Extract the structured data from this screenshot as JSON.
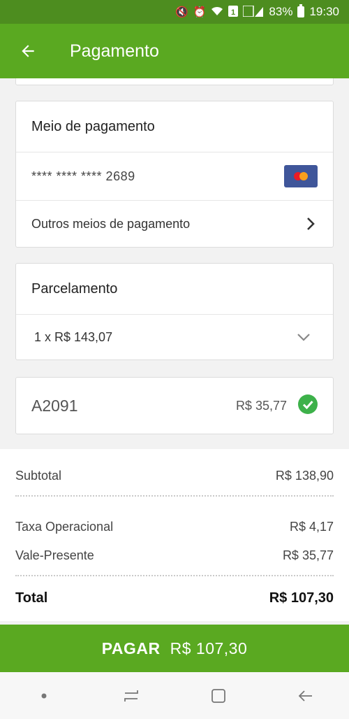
{
  "status_bar": {
    "battery": "83%",
    "time": "19:30",
    "icons": [
      "mute-icon",
      "alarm-icon",
      "wifi-icon",
      "sim-icon",
      "signal-icon",
      "battery-icon"
    ]
  },
  "app_bar": {
    "title": "Pagamento",
    "back_icon": "arrow-back-icon"
  },
  "payment_method": {
    "header": "Meio de pagamento",
    "card_number": "**** **** **** 2689",
    "card_brand_icon": "mastercard-icon",
    "other_methods": "Outros meios de pagamento"
  },
  "installments": {
    "header": "Parcelamento",
    "selected": "1 x R$ 143,07"
  },
  "voucher": {
    "code": "A2091",
    "amount": "R$ 35,77",
    "status_icon": "check-circle-icon"
  },
  "summary": {
    "subtotal_label": "Subtotal",
    "subtotal_value": "R$ 138,90",
    "fee_label": "Taxa Operacional",
    "fee_value": "R$ 4,17",
    "gift_label": "Vale-Presente",
    "gift_value": "R$ 35,77",
    "total_label": "Total",
    "total_value": "R$ 107,30"
  },
  "pay_button": {
    "label": "PAGAR",
    "amount": "R$ 107,30"
  },
  "colors": {
    "primary": "#5aa921",
    "status_bar": "#4d8d1f",
    "success": "#3db14a"
  }
}
